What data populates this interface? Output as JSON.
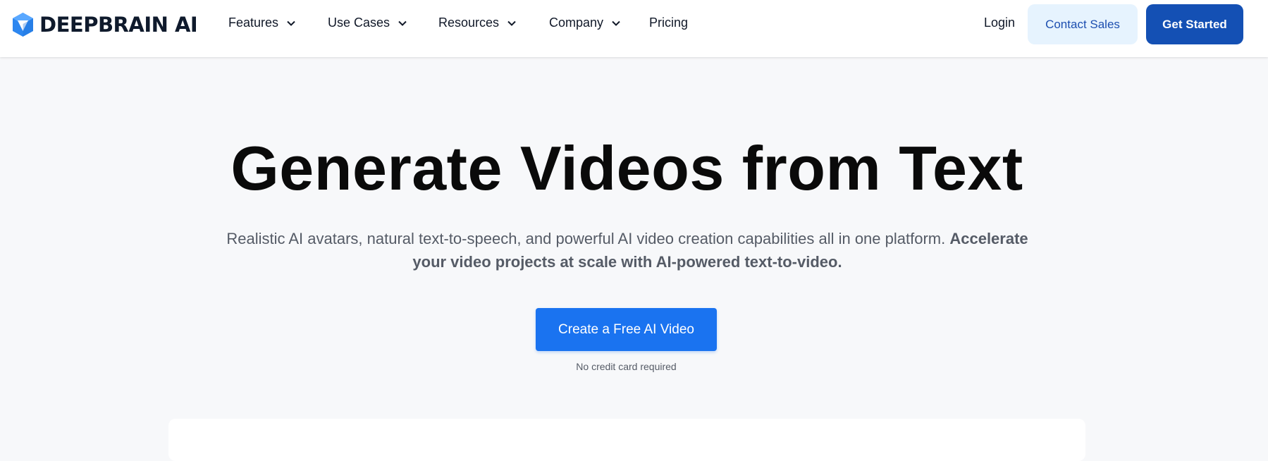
{
  "brand": {
    "name": "DEEPBRAIN AI",
    "logo_icon": "deepbrain-cube-logo",
    "color": "#2d87f0"
  },
  "nav": {
    "items": [
      {
        "label": "Features",
        "has_dropdown": true
      },
      {
        "label": "Use Cases",
        "has_dropdown": true
      },
      {
        "label": "Resources",
        "has_dropdown": true
      },
      {
        "label": "Company",
        "has_dropdown": true
      },
      {
        "label": "Pricing",
        "has_dropdown": false
      }
    ],
    "login_label": "Login",
    "contact_label": "Contact Sales",
    "get_started_label": "Get Started"
  },
  "hero": {
    "title": "Generate Videos from Text",
    "subtitle_plain": "Realistic AI avatars, natural text-to-speech, and powerful AI video creation capabilities all in one platform. ",
    "subtitle_bold": "Accelerate your video projects at scale with AI-powered text-to-video.",
    "cta_label": "Create a Free AI Video",
    "cta_note": "No credit card required"
  },
  "colors": {
    "primary": "#1a73f0",
    "dark_button": "#1450b4",
    "light_button": "#e6f3fe",
    "background": "#f7f8fa"
  }
}
